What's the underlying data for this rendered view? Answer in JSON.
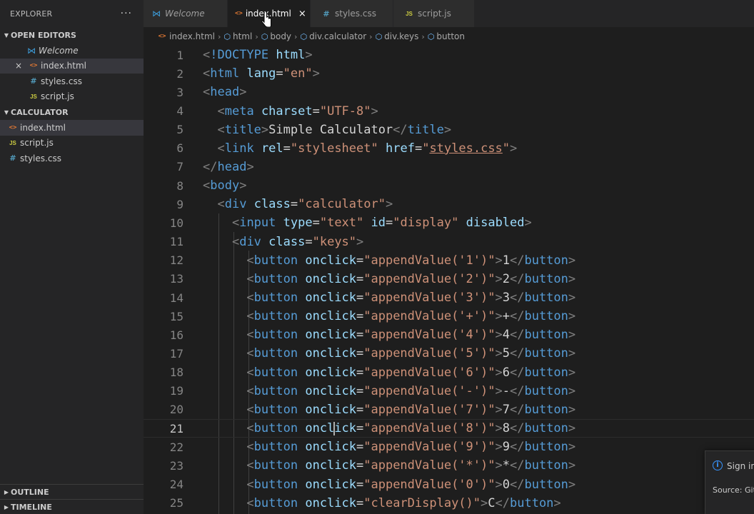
{
  "explorer": {
    "title": "EXPLORER",
    "more": "···",
    "open_editors": {
      "label": "OPEN EDITORS",
      "items": [
        {
          "label": "Welcome"
        },
        {
          "label": "index.html"
        },
        {
          "label": "styles.css"
        },
        {
          "label": "script.js"
        }
      ]
    },
    "folder": {
      "label": "CALCULATOR",
      "items": [
        {
          "label": "index.html"
        },
        {
          "label": "script.js"
        },
        {
          "label": "styles.css"
        }
      ]
    },
    "outline": "OUTLINE",
    "timeline": "TIMELINE"
  },
  "tabs": [
    {
      "label": "Welcome"
    },
    {
      "label": "index.html"
    },
    {
      "label": "styles.css"
    },
    {
      "label": "script.js"
    }
  ],
  "icons": {
    "html": "<>",
    "css": "#",
    "js": "JS",
    "close": "×"
  },
  "breadcrumb": [
    "index.html",
    "html",
    "body",
    "div.calculator",
    "div.keys",
    "button"
  ],
  "editor": {
    "current_line": 21,
    "lines": [
      {
        "n": "1",
        "tokens": [
          [
            "tg",
            "<"
          ],
          [
            "tn",
            "!DOCTYPE"
          ],
          [
            "tx",
            " "
          ],
          [
            "at",
            "html"
          ],
          [
            "tg",
            ">"
          ]
        ]
      },
      {
        "n": "2",
        "tokens": [
          [
            "tg",
            "<"
          ],
          [
            "tn",
            "html"
          ],
          [
            "tx",
            " "
          ],
          [
            "at",
            "lang"
          ],
          [
            "tx",
            "="
          ],
          [
            "st",
            "\"en\""
          ],
          [
            "tg",
            ">"
          ]
        ]
      },
      {
        "n": "3",
        "tokens": [
          [
            "tg",
            "<"
          ],
          [
            "tn",
            "head"
          ],
          [
            "tg",
            ">"
          ]
        ]
      },
      {
        "n": "4",
        "tokens": [
          [
            "tx",
            "  "
          ],
          [
            "tg",
            "<"
          ],
          [
            "tn",
            "meta"
          ],
          [
            "tx",
            " "
          ],
          [
            "at",
            "charset"
          ],
          [
            "tx",
            "="
          ],
          [
            "st",
            "\"UTF-8\""
          ],
          [
            "tg",
            ">"
          ]
        ]
      },
      {
        "n": "5",
        "tokens": [
          [
            "tx",
            "  "
          ],
          [
            "tg",
            "<"
          ],
          [
            "tn",
            "title"
          ],
          [
            "tg",
            ">"
          ],
          [
            "tx",
            "Simple Calculator"
          ],
          [
            "tg",
            "</"
          ],
          [
            "tn",
            "title"
          ],
          [
            "tg",
            ">"
          ]
        ]
      },
      {
        "n": "6",
        "tokens": [
          [
            "tx",
            "  "
          ],
          [
            "tg",
            "<"
          ],
          [
            "tn",
            "link"
          ],
          [
            "tx",
            " "
          ],
          [
            "at",
            "rel"
          ],
          [
            "tx",
            "="
          ],
          [
            "st",
            "\"stylesheet\""
          ],
          [
            "tx",
            " "
          ],
          [
            "at",
            "href"
          ],
          [
            "tx",
            "="
          ],
          [
            "st",
            "\""
          ],
          [
            "stu",
            "styles.css"
          ],
          [
            "st",
            "\""
          ],
          [
            "tg",
            ">"
          ]
        ]
      },
      {
        "n": "7",
        "tokens": [
          [
            "tg",
            "</"
          ],
          [
            "tn",
            "head"
          ],
          [
            "tg",
            ">"
          ]
        ]
      },
      {
        "n": "8",
        "tokens": [
          [
            "tg",
            "<"
          ],
          [
            "tn",
            "body"
          ],
          [
            "tg",
            ">"
          ]
        ]
      },
      {
        "n": "9",
        "tokens": [
          [
            "tx",
            "  "
          ],
          [
            "tg",
            "<"
          ],
          [
            "tn",
            "div"
          ],
          [
            "tx",
            " "
          ],
          [
            "at",
            "class"
          ],
          [
            "tx",
            "="
          ],
          [
            "st",
            "\"calculator\""
          ],
          [
            "tg",
            ">"
          ]
        ]
      },
      {
        "n": "10",
        "tokens": [
          [
            "tx",
            "    "
          ],
          [
            "tg",
            "<"
          ],
          [
            "tn",
            "input"
          ],
          [
            "tx",
            " "
          ],
          [
            "at",
            "type"
          ],
          [
            "tx",
            "="
          ],
          [
            "st",
            "\"text\""
          ],
          [
            "tx",
            " "
          ],
          [
            "at",
            "id"
          ],
          [
            "tx",
            "="
          ],
          [
            "st",
            "\"display\""
          ],
          [
            "tx",
            " "
          ],
          [
            "at",
            "disabled"
          ],
          [
            "tg",
            ">"
          ]
        ]
      },
      {
        "n": "11",
        "tokens": [
          [
            "tx",
            "    "
          ],
          [
            "tg",
            "<"
          ],
          [
            "tn",
            "div"
          ],
          [
            "tx",
            " "
          ],
          [
            "at",
            "class"
          ],
          [
            "tx",
            "="
          ],
          [
            "st",
            "\"keys\""
          ],
          [
            "tg",
            ">"
          ]
        ]
      },
      {
        "n": "12",
        "tokens": [
          [
            "tx",
            "      "
          ],
          [
            "tg",
            "<"
          ],
          [
            "tn",
            "button"
          ],
          [
            "tx",
            " "
          ],
          [
            "at",
            "onclick"
          ],
          [
            "tx",
            "="
          ],
          [
            "st",
            "\"appendValue('1')\""
          ],
          [
            "tg",
            ">"
          ],
          [
            "tx",
            "1"
          ],
          [
            "tg",
            "</"
          ],
          [
            "tn",
            "button"
          ],
          [
            "tg",
            ">"
          ]
        ]
      },
      {
        "n": "13",
        "tokens": [
          [
            "tx",
            "      "
          ],
          [
            "tg",
            "<"
          ],
          [
            "tn",
            "button"
          ],
          [
            "tx",
            " "
          ],
          [
            "at",
            "onclick"
          ],
          [
            "tx",
            "="
          ],
          [
            "st",
            "\"appendValue('2')\""
          ],
          [
            "tg",
            ">"
          ],
          [
            "tx",
            "2"
          ],
          [
            "tg",
            "</"
          ],
          [
            "tn",
            "button"
          ],
          [
            "tg",
            ">"
          ]
        ]
      },
      {
        "n": "14",
        "tokens": [
          [
            "tx",
            "      "
          ],
          [
            "tg",
            "<"
          ],
          [
            "tn",
            "button"
          ],
          [
            "tx",
            " "
          ],
          [
            "at",
            "onclick"
          ],
          [
            "tx",
            "="
          ],
          [
            "st",
            "\"appendValue('3')\""
          ],
          [
            "tg",
            ">"
          ],
          [
            "tx",
            "3"
          ],
          [
            "tg",
            "</"
          ],
          [
            "tn",
            "button"
          ],
          [
            "tg",
            ">"
          ]
        ]
      },
      {
        "n": "15",
        "tokens": [
          [
            "tx",
            "      "
          ],
          [
            "tg",
            "<"
          ],
          [
            "tn",
            "button"
          ],
          [
            "tx",
            " "
          ],
          [
            "at",
            "onclick"
          ],
          [
            "tx",
            "="
          ],
          [
            "st",
            "\"appendValue('+')\""
          ],
          [
            "tg",
            ">"
          ],
          [
            "tx",
            "+"
          ],
          [
            "tg",
            "</"
          ],
          [
            "tn",
            "button"
          ],
          [
            "tg",
            ">"
          ]
        ]
      },
      {
        "n": "16",
        "tokens": [
          [
            "tx",
            "      "
          ],
          [
            "tg",
            "<"
          ],
          [
            "tn",
            "button"
          ],
          [
            "tx",
            " "
          ],
          [
            "at",
            "onclick"
          ],
          [
            "tx",
            "="
          ],
          [
            "st",
            "\"appendValue('4')\""
          ],
          [
            "tg",
            ">"
          ],
          [
            "tx",
            "4"
          ],
          [
            "tg",
            "</"
          ],
          [
            "tn",
            "button"
          ],
          [
            "tg",
            ">"
          ]
        ]
      },
      {
        "n": "17",
        "tokens": [
          [
            "tx",
            "      "
          ],
          [
            "tg",
            "<"
          ],
          [
            "tn",
            "button"
          ],
          [
            "tx",
            " "
          ],
          [
            "at",
            "onclick"
          ],
          [
            "tx",
            "="
          ],
          [
            "st",
            "\"appendValue('5')\""
          ],
          [
            "tg",
            ">"
          ],
          [
            "tx",
            "5"
          ],
          [
            "tg",
            "</"
          ],
          [
            "tn",
            "button"
          ],
          [
            "tg",
            ">"
          ]
        ]
      },
      {
        "n": "18",
        "tokens": [
          [
            "tx",
            "      "
          ],
          [
            "tg",
            "<"
          ],
          [
            "tn",
            "button"
          ],
          [
            "tx",
            " "
          ],
          [
            "at",
            "onclick"
          ],
          [
            "tx",
            "="
          ],
          [
            "st",
            "\"appendValue('6')\""
          ],
          [
            "tg",
            ">"
          ],
          [
            "tx",
            "6"
          ],
          [
            "tg",
            "</"
          ],
          [
            "tn",
            "button"
          ],
          [
            "tg",
            ">"
          ]
        ]
      },
      {
        "n": "19",
        "tokens": [
          [
            "tx",
            "      "
          ],
          [
            "tg",
            "<"
          ],
          [
            "tn",
            "button"
          ],
          [
            "tx",
            " "
          ],
          [
            "at",
            "onclick"
          ],
          [
            "tx",
            "="
          ],
          [
            "st",
            "\"appendValue('-')\""
          ],
          [
            "tg",
            ">"
          ],
          [
            "tx",
            "-"
          ],
          [
            "tg",
            "</"
          ],
          [
            "tn",
            "button"
          ],
          [
            "tg",
            ">"
          ]
        ]
      },
      {
        "n": "20",
        "tokens": [
          [
            "tx",
            "      "
          ],
          [
            "tg",
            "<"
          ],
          [
            "tn",
            "button"
          ],
          [
            "tx",
            " "
          ],
          [
            "at",
            "onclick"
          ],
          [
            "tx",
            "="
          ],
          [
            "st",
            "\"appendValue('7')\""
          ],
          [
            "tg",
            ">"
          ],
          [
            "tx",
            "7"
          ],
          [
            "tg",
            "</"
          ],
          [
            "tn",
            "button"
          ],
          [
            "tg",
            ">"
          ]
        ]
      },
      {
        "n": "21",
        "tokens": [
          [
            "tx",
            "      "
          ],
          [
            "tg",
            "<"
          ],
          [
            "tn",
            "button"
          ],
          [
            "tx",
            " "
          ],
          [
            "at",
            "oncl"
          ],
          [
            "caret",
            ""
          ],
          [
            "at",
            "ick"
          ],
          [
            "tx",
            "="
          ],
          [
            "st",
            "\"appendValue('8')\""
          ],
          [
            "tg",
            ">"
          ],
          [
            "tx",
            "8"
          ],
          [
            "tg",
            "</"
          ],
          [
            "tn",
            "button"
          ],
          [
            "tg",
            ">"
          ]
        ]
      },
      {
        "n": "22",
        "tokens": [
          [
            "tx",
            "      "
          ],
          [
            "tg",
            "<"
          ],
          [
            "tn",
            "button"
          ],
          [
            "tx",
            " "
          ],
          [
            "at",
            "onclick"
          ],
          [
            "tx",
            "="
          ],
          [
            "st",
            "\"appendValue('9')\""
          ],
          [
            "tg",
            ">"
          ],
          [
            "tx",
            "9"
          ],
          [
            "tg",
            "</"
          ],
          [
            "tn",
            "button"
          ],
          [
            "tg",
            ">"
          ]
        ]
      },
      {
        "n": "23",
        "tokens": [
          [
            "tx",
            "      "
          ],
          [
            "tg",
            "<"
          ],
          [
            "tn",
            "button"
          ],
          [
            "tx",
            " "
          ],
          [
            "at",
            "onclick"
          ],
          [
            "tx",
            "="
          ],
          [
            "st",
            "\"appendValue('*')\""
          ],
          [
            "tg",
            ">"
          ],
          [
            "tx",
            "*"
          ],
          [
            "tg",
            "</"
          ],
          [
            "tn",
            "button"
          ],
          [
            "tg",
            ">"
          ]
        ]
      },
      {
        "n": "24",
        "tokens": [
          [
            "tx",
            "      "
          ],
          [
            "tg",
            "<"
          ],
          [
            "tn",
            "button"
          ],
          [
            "tx",
            " "
          ],
          [
            "at",
            "onclick"
          ],
          [
            "tx",
            "="
          ],
          [
            "st",
            "\"appendValue('0')\""
          ],
          [
            "tg",
            ">"
          ],
          [
            "tx",
            "0"
          ],
          [
            "tg",
            "</"
          ],
          [
            "tn",
            "button"
          ],
          [
            "tg",
            ">"
          ]
        ]
      },
      {
        "n": "25",
        "tokens": [
          [
            "tx",
            "      "
          ],
          [
            "tg",
            "<"
          ],
          [
            "tn",
            "button"
          ],
          [
            "tx",
            " "
          ],
          [
            "at",
            "onclick"
          ],
          [
            "tx",
            "="
          ],
          [
            "st",
            "\"clearDisplay()\""
          ],
          [
            "tg",
            ">"
          ],
          [
            "tx",
            "C"
          ],
          [
            "tg",
            "</"
          ],
          [
            "tn",
            "button"
          ],
          [
            "tg",
            ">"
          ]
        ]
      }
    ]
  },
  "notification": {
    "message": "Sign in",
    "source": "Source: Git"
  },
  "colors": {
    "tag_bracket": "#808080",
    "tag_name": "#569cd6",
    "attribute": "#9cdcfe",
    "string": "#ce9178",
    "text": "#d4d4d4",
    "line_number": "#858585"
  }
}
